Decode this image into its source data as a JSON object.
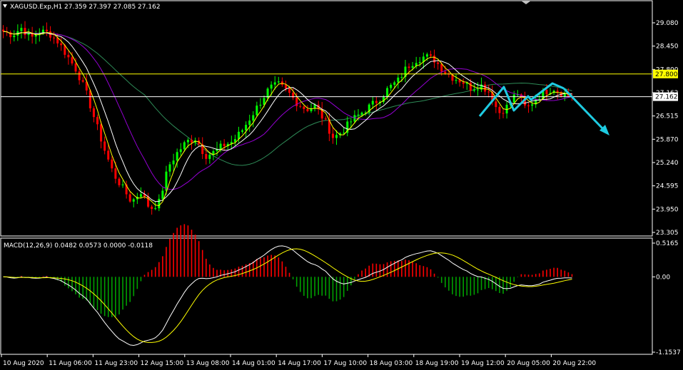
{
  "header": {
    "menu_icon": "triangle-down-icon",
    "symbol": "XAGUSD.Exp,H1",
    "ohlc": "27.359 27.397 27.085 27.162"
  },
  "macd_header": {
    "label": "MACD(12,26,9) 0.0482 0.0573 0.0000 -0.0118"
  },
  "price_axis": {
    "ticks": [
      "29.080",
      "28.450",
      "27.800",
      "27.162",
      "26.515",
      "25.870",
      "25.240",
      "24.595",
      "23.950",
      "23.305"
    ],
    "highlight_labels": [
      {
        "text": "27.800",
        "color": "#ffff00"
      },
      {
        "text": "27.162",
        "color": "#ffffff"
      }
    ]
  },
  "macd_axis": {
    "ticks": [
      "0.5165",
      "0.00",
      "-1.1537"
    ]
  },
  "time_axis": {
    "ticks": [
      "10 Aug 2020",
      "11 Aug 06:00",
      "11 Aug 23:00",
      "12 Aug 15:00",
      "13 Aug 08:00",
      "14 Aug 01:00",
      "14 Aug 17:00",
      "17 Aug 10:00",
      "18 Aug 03:00",
      "18 Aug 19:00",
      "19 Aug 12:00",
      "20 Aug 05:00",
      "20 Aug 22:00"
    ]
  },
  "colors": {
    "background": "#000000",
    "bull_candle": "#00ff00",
    "bear_candle": "#ff0000",
    "ma_fast": "#ffff00",
    "ma_mid": "#ffffff",
    "ma_slow": "#9400d3",
    "ma_long": "#2e8b57",
    "level_line": "#ffff00",
    "pattern_line": "#1ecbe1",
    "macd_pos": "#ff0000",
    "macd_neg": "#00a000",
    "macd_line": "#ffffff",
    "signal_line": "#ffff00"
  },
  "chart_data": {
    "type": "candlestick",
    "symbol": "XAGUSD.Exp",
    "timeframe": "H1",
    "last_close": 27.162,
    "horizontal_levels": [
      27.8,
      27.162
    ],
    "ylim": [
      23.305,
      29.6
    ],
    "close_path": [
      29.0,
      28.9,
      29.1,
      28.8,
      29.0,
      28.95,
      28.7,
      28.3,
      27.9,
      27.3,
      26.5,
      25.7,
      25.0,
      24.6,
      24.2,
      24.5,
      24.0,
      24.2,
      25.2,
      25.6,
      25.9,
      26.0,
      25.5,
      25.6,
      25.8,
      25.9,
      26.2,
      26.6,
      27.0,
      27.4,
      27.5,
      27.3,
      27.0,
      26.8,
      26.9,
      26.5,
      26.0,
      26.2,
      26.5,
      26.7,
      26.9,
      27.1,
      27.4,
      27.6,
      28.0,
      28.2,
      28.3,
      28.2,
      27.9,
      27.7,
      27.6,
      27.4,
      27.5,
      27.3,
      26.7,
      26.9,
      27.3,
      26.8,
      27.1,
      27.3,
      27.4,
      27.25,
      27.162
    ],
    "macd": {
      "params": "12,26,9",
      "main": 0.0482,
      "signal": 0.0573,
      "value3": 0.0,
      "value4": -0.0118,
      "ylim": [
        -1.1537,
        0.5165
      ]
    }
  }
}
